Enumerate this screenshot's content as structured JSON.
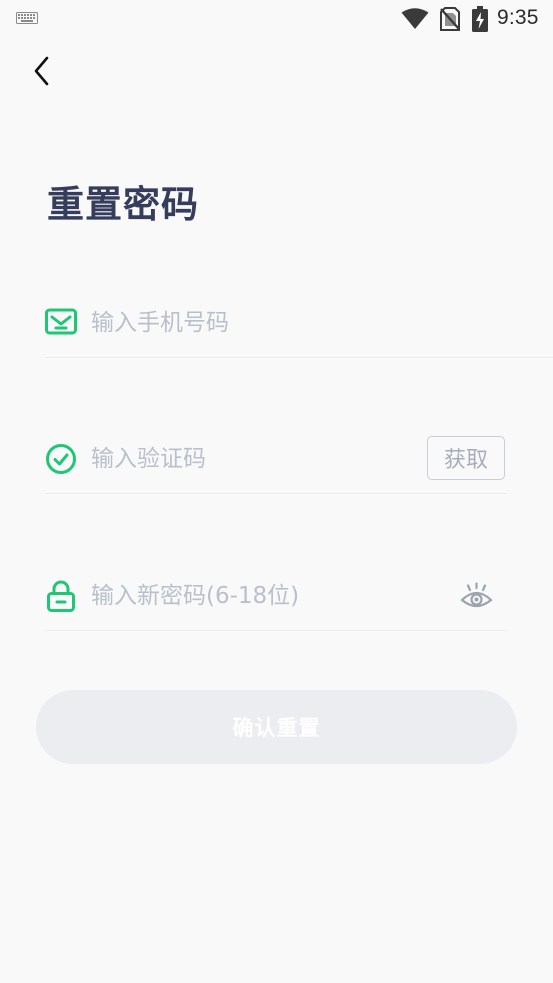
{
  "status_bar": {
    "time": "9:35",
    "icons": [
      "keyboard-icon",
      "wifi-icon",
      "no-sim-icon",
      "battery-charging-icon"
    ]
  },
  "header": {
    "back_icon": "chevron-left-icon"
  },
  "title": "重置密码",
  "phone": {
    "icon": "envelope-icon",
    "placeholder": "输入手机号码",
    "value": ""
  },
  "code": {
    "icon": "check-circle-icon",
    "placeholder": "输入验证码",
    "value": "",
    "get_code_label": "获取"
  },
  "password": {
    "icon": "lock-icon",
    "placeholder": "输入新密码(6-18位)",
    "value": "",
    "toggle_icon": "eye-icon"
  },
  "confirm_label": "确认重置",
  "colors": {
    "accent": "#1dc774",
    "title": "#363d5c",
    "placeholder": "#b9c0cc",
    "disabled_button": "#ecedf0",
    "background": "#f9f9fa"
  }
}
